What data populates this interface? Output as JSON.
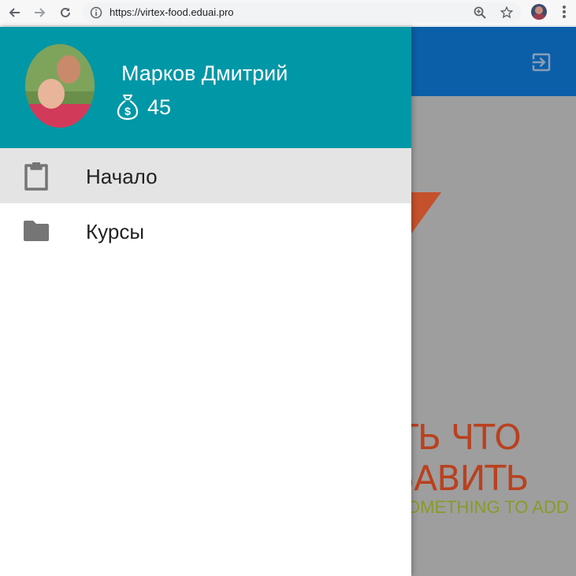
{
  "browser": {
    "url": "https://virtex-food.eduai.pro",
    "back_icon": "arrow-left-icon",
    "forward_icon": "arrow-right-icon",
    "reload_icon": "reload-icon",
    "info_icon": "info-icon",
    "zoom_icon": "zoom-icon",
    "bookmark_icon": "star-icon",
    "menu_icon": "more-vert-icon"
  },
  "page": {
    "promo_line1": "ТЬ ЧТО",
    "promo_line2": "БАВИТЬ",
    "promo_line3": "OMETHING TO ADD",
    "colors": {
      "header": "#0b5fa8",
      "overlay": "#9e9e9e",
      "promo": "#b9411f",
      "promo_sub": "#8a9a2a"
    }
  },
  "drawer": {
    "user": {
      "name": "Марков Дмитрий",
      "coins": "45"
    },
    "colors": {
      "header": "#0097a7",
      "active": "#e4e4e4"
    },
    "menu": [
      {
        "label": "Начало",
        "icon": "clipboard-icon",
        "active": true
      },
      {
        "label": "Курсы",
        "icon": "folder-icon",
        "active": false
      }
    ]
  }
}
